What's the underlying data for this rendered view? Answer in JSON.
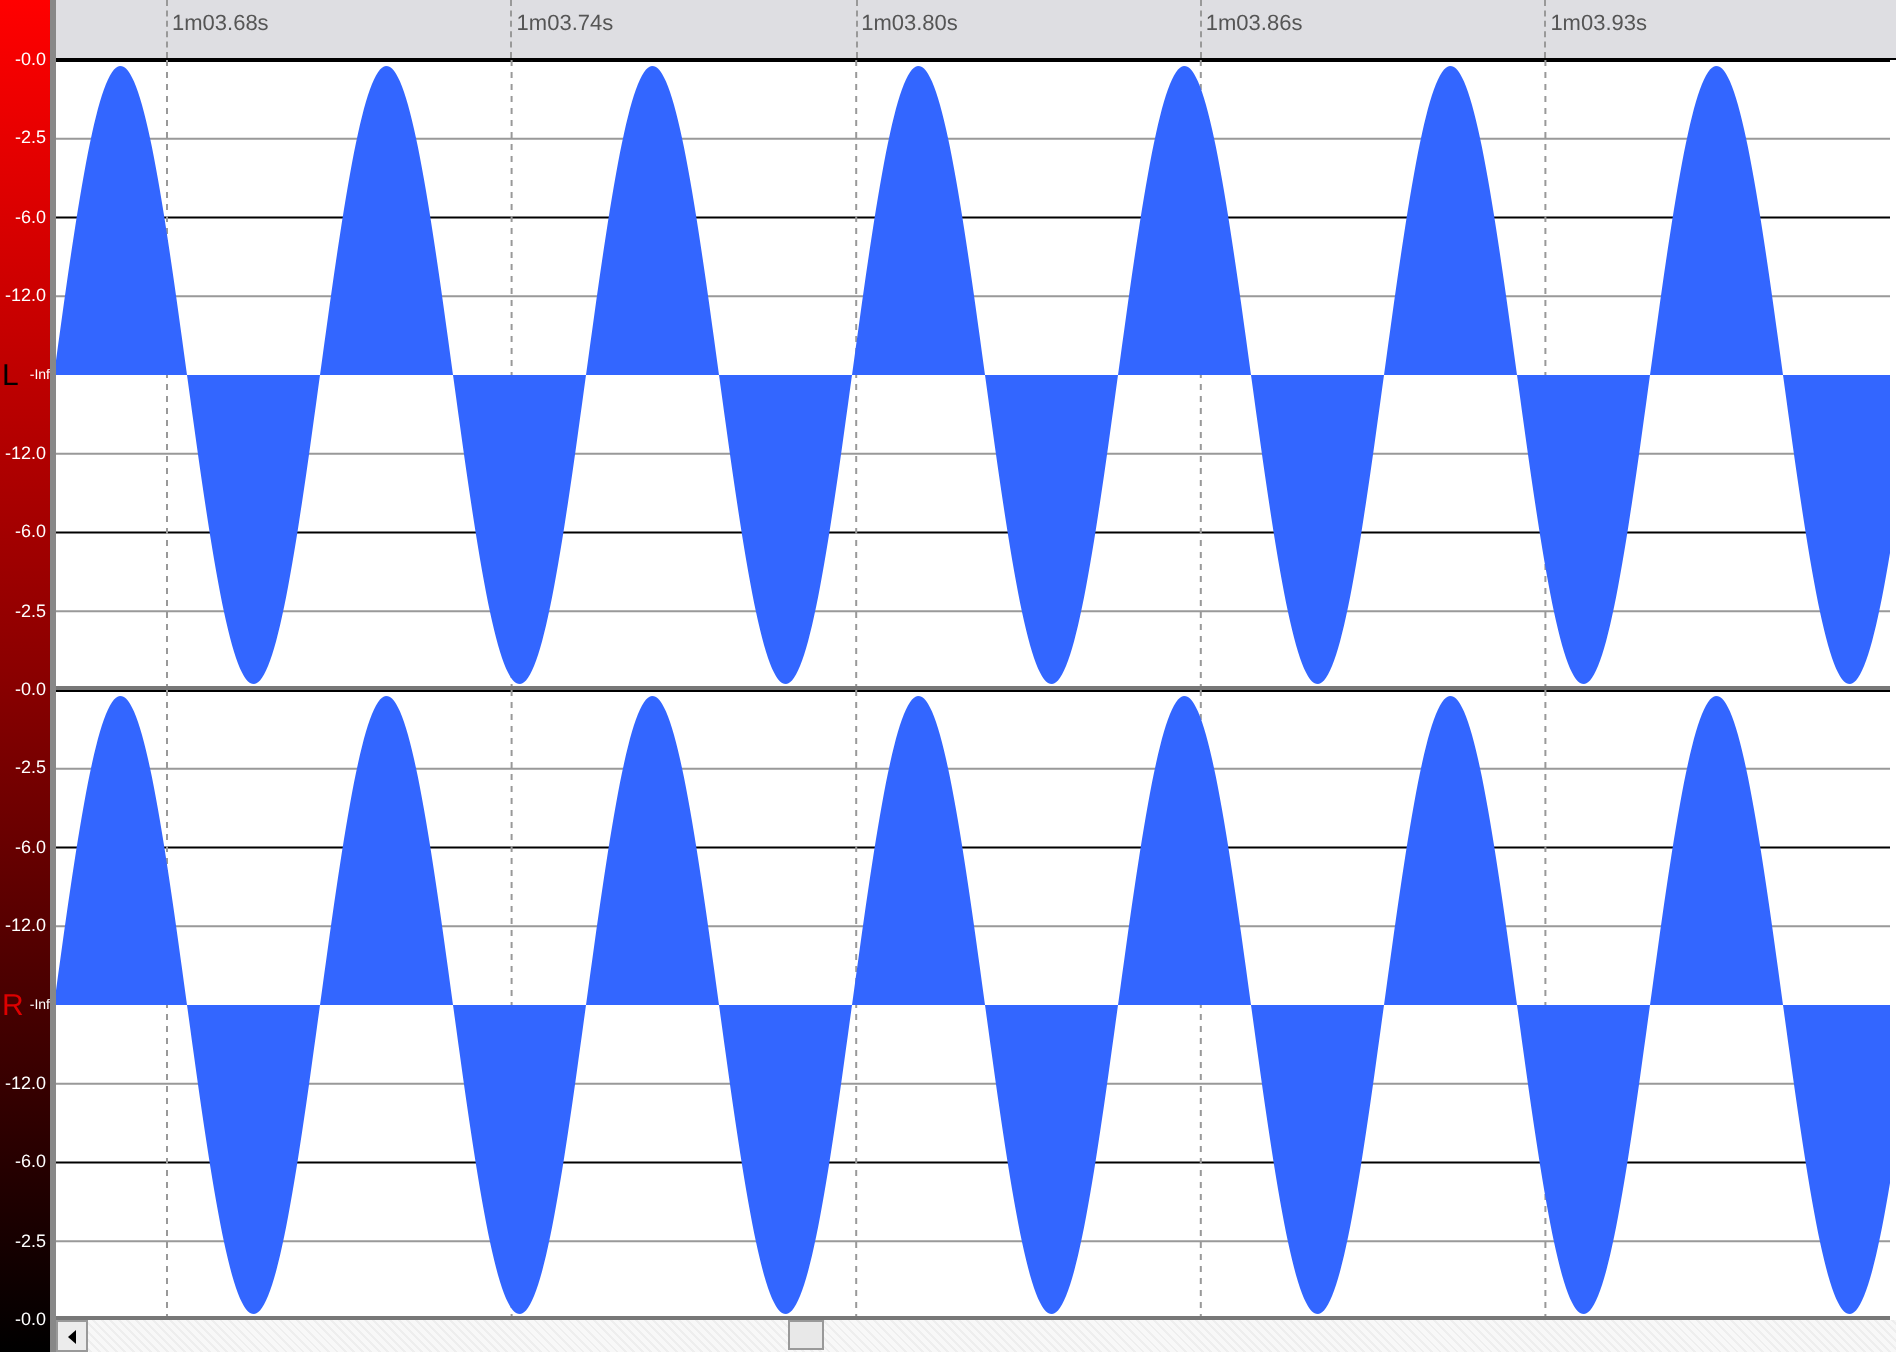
{
  "ruler": {
    "labels": [
      "1m03.68s",
      "1m03.74s",
      "1m03.80s",
      "1m03.86s",
      "1m03.93s"
    ]
  },
  "channels": [
    {
      "name": "L",
      "color": "#000000",
      "scale": [
        "-0.0",
        "-2.5",
        "-6.0",
        "-12.0",
        "-Inf",
        "-12.0",
        "-6.0",
        "-2.5"
      ]
    },
    {
      "name": "R",
      "color": "#dd0000",
      "scale": [
        "-0.0",
        "-2.5",
        "-6.0",
        "-12.0",
        "-Inf",
        "-12.0",
        "-6.0",
        "-2.5",
        "-0.0"
      ]
    }
  ]
}
